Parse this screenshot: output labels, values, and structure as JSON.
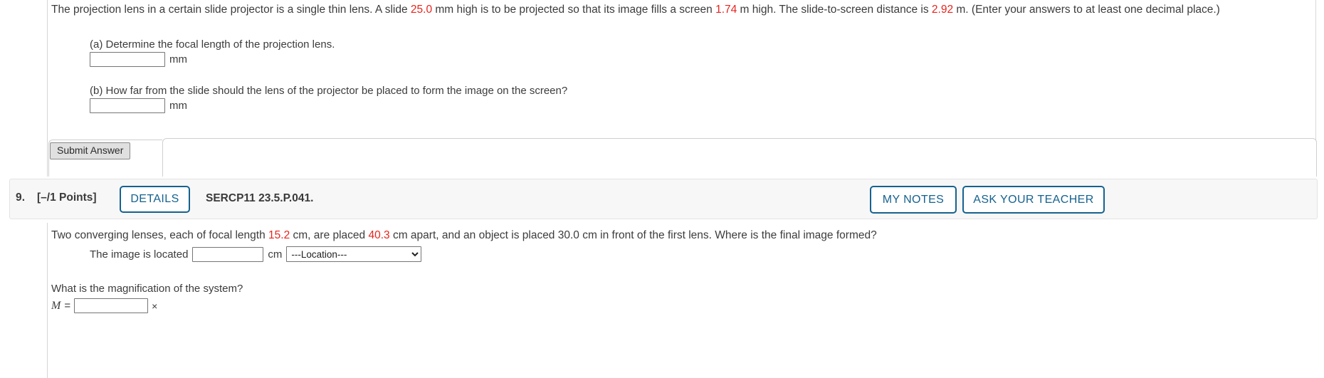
{
  "question8": {
    "stem_parts": [
      {
        "text": "The projection lens in a certain slide projector is a single thin lens. A slide ",
        "highlight": false
      },
      {
        "text": "25.0",
        "highlight": true
      },
      {
        "text": " mm high is to be projected so that its image fills a screen ",
        "highlight": false
      },
      {
        "text": "1.74",
        "highlight": true
      },
      {
        "text": " m high. The slide-to-screen distance is ",
        "highlight": false
      },
      {
        "text": "2.92",
        "highlight": true
      },
      {
        "text": " m. (Enter your answers to at least one decimal place.)",
        "highlight": false
      }
    ],
    "part_a_label": "(a) Determine the focal length of the projection lens.",
    "part_a_value": "",
    "part_a_unit": "mm",
    "part_b_label": "(b) How far from the slide should the lens of the projector be placed to form the image on the screen?",
    "part_b_value": "",
    "part_b_unit": "mm",
    "submit_label": "Submit Answer"
  },
  "question9": {
    "number": "9.",
    "points": "[–/1 Points]",
    "details_label": "DETAILS",
    "code": "SERCP11 23.5.P.041.",
    "my_notes_label": "MY NOTES",
    "ask_teacher_label": "ASK YOUR TEACHER",
    "stem_parts": [
      {
        "text": "Two converging lenses, each of focal length ",
        "highlight": false
      },
      {
        "text": "15.2",
        "highlight": true
      },
      {
        "text": " cm, are placed ",
        "highlight": false
      },
      {
        "text": "40.3",
        "highlight": true
      },
      {
        "text": " cm apart, and an object is placed 30.0 cm in front of the first lens. Where is the final image formed?",
        "highlight": false
      }
    ],
    "image_located_label": "The image is located",
    "image_located_value": "",
    "image_located_unit": "cm",
    "location_select_value": "---Location---",
    "location_options": [
      "---Location---"
    ],
    "magnification_question": "What is the magnification of the system?",
    "magnification_var": "M",
    "magnification_equals": "=",
    "magnification_value": "",
    "magnification_unit": "×"
  },
  "colors": {
    "highlight": "#e8231c",
    "link_blue": "#15628f",
    "header_bg": "#f7f7f7",
    "text": "#3c3c3c"
  }
}
